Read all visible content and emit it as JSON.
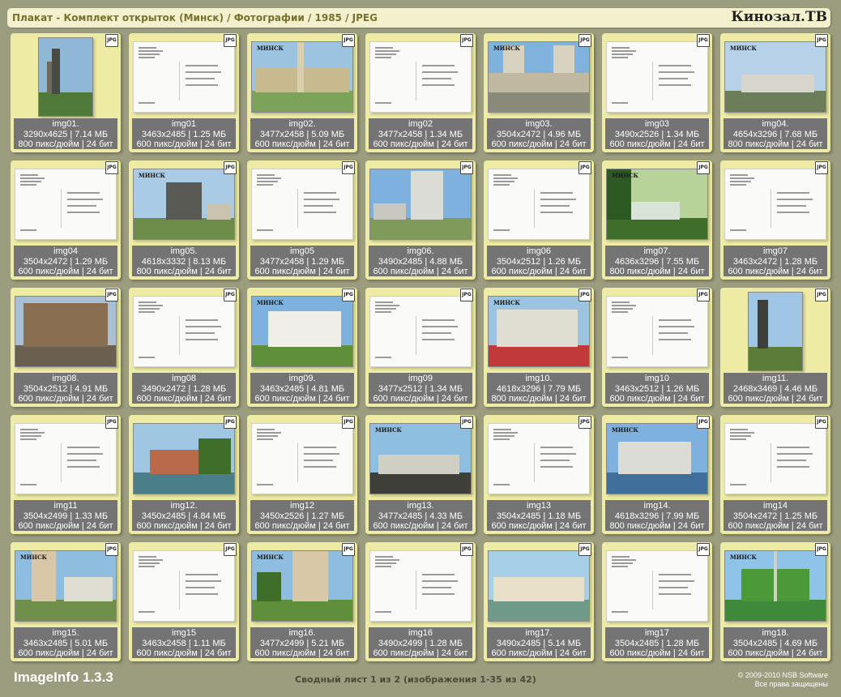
{
  "header": {
    "title": "Плакат - Комплект открыток (Минск) / Фотографии / 1985 / JPEG",
    "brand": "Кинозал.ТВ"
  },
  "thumbnail_badge": "JPG",
  "photo_caption": "МИНСК",
  "tiles": [
    {
      "kind": "photo",
      "orient": "portrait",
      "scene": "monument",
      "caption": false,
      "name": "img01.",
      "size": "3290x4625 | 7.14 МБ",
      "res": "800 пикс/дюйм | 24 бит"
    },
    {
      "kind": "back",
      "orient": "landscape",
      "name": "img01",
      "size": "3463x2485 | 1.25 МБ",
      "res": "600 пикс/дюйм | 24 бит"
    },
    {
      "kind": "photo",
      "orient": "landscape",
      "scene": "square",
      "caption": true,
      "name": "img02.",
      "size": "3477x2458 | 5.09 МБ",
      "res": "600 пикс/дюйм | 24 бит"
    },
    {
      "kind": "back",
      "orient": "landscape",
      "name": "img02",
      "size": "3477x2458 | 1.34 МБ",
      "res": "600 пикс/дюйм | 24 бит"
    },
    {
      "kind": "photo",
      "orient": "landscape",
      "scene": "towers",
      "caption": true,
      "name": "img03.",
      "size": "3504x2472 | 4.96 МБ",
      "res": "600 пикс/дюйм | 24 бит"
    },
    {
      "kind": "back",
      "orient": "landscape",
      "name": "img03",
      "size": "3490x2526 | 1.34 МБ",
      "res": "600 пикс/дюйм | 24 бит"
    },
    {
      "kind": "photo",
      "orient": "landscape",
      "scene": "avenue",
      "caption": true,
      "name": "img04.",
      "size": "4654x3296 | 7.68 МБ",
      "res": "800 пикс/дюйм | 24 бит"
    },
    {
      "kind": "back",
      "orient": "landscape",
      "name": "img04",
      "size": "3504x2472 | 1.29 МБ",
      "res": "600 пикс/дюйм | 24 бит"
    },
    {
      "kind": "photo",
      "orient": "landscape",
      "scene": "statue",
      "caption": true,
      "name": "img05.",
      "size": "4618x3332 | 8.13 МБ",
      "res": "800 пикс/дюйм | 24 бит"
    },
    {
      "kind": "back",
      "orient": "landscape",
      "name": "img05",
      "size": "3477x2458 | 1.29 МБ",
      "res": "600 пикс/дюйм | 24 бит"
    },
    {
      "kind": "photo",
      "orient": "landscape",
      "scene": "hotel",
      "caption": false,
      "name": "img06.",
      "size": "3490x2485 | 4.88 МБ",
      "res": "600 пикс/дюйм | 24 бит"
    },
    {
      "kind": "back",
      "orient": "landscape",
      "name": "img06",
      "size": "3504x2512 | 1.26 МБ",
      "res": "600 пикс/дюйм | 24 бит"
    },
    {
      "kind": "photo",
      "orient": "landscape",
      "scene": "park",
      "caption": true,
      "name": "img07.",
      "size": "4636x3296 | 7.55 МБ",
      "res": "800 пикс/дюйм | 24 бит"
    },
    {
      "kind": "back",
      "orient": "landscape",
      "name": "img07",
      "size": "3463x2472 | 1.28 МБ",
      "res": "600 пикс/дюйм | 24 бит"
    },
    {
      "kind": "photo",
      "orient": "landscape",
      "scene": "classic",
      "caption": false,
      "name": "img08.",
      "size": "3504x2512 | 4.91 МБ",
      "res": "600 пикс/дюйм | 24 бит"
    },
    {
      "kind": "back",
      "orient": "landscape",
      "name": "img08",
      "size": "3490x2472 | 1.28 МБ",
      "res": "600 пикс/дюйм | 24 бит"
    },
    {
      "kind": "photo",
      "orient": "landscape",
      "scene": "white",
      "caption": true,
      "name": "img09.",
      "size": "3463x2485 | 4.81 МБ",
      "res": "600 пикс/дюйм | 24 бит"
    },
    {
      "kind": "back",
      "orient": "landscape",
      "name": "img09",
      "size": "3477x2512 | 1.34 МБ",
      "res": "600 пикс/дюйм | 24 бит"
    },
    {
      "kind": "photo",
      "orient": "landscape",
      "scene": "flowers",
      "caption": true,
      "name": "img10.",
      "size": "4618x3296 | 7.79 МБ",
      "res": "800 пикс/дюйм | 24 бит"
    },
    {
      "kind": "back",
      "orient": "landscape",
      "name": "img10",
      "size": "3463x2512 | 1.26 МБ",
      "res": "600 пикс/дюйм | 24 бит"
    },
    {
      "kind": "photo",
      "orient": "portrait",
      "scene": "statue2",
      "caption": false,
      "name": "img11.",
      "size": "2468x3469 | 4.46 МБ",
      "res": "600 пикс/дюйм | 24 бит"
    },
    {
      "kind": "back",
      "orient": "landscape",
      "name": "img11",
      "size": "3504x2499 | 1.33 МБ",
      "res": "600 пикс/дюйм | 24 бит"
    },
    {
      "kind": "photo",
      "orient": "landscape",
      "scene": "river",
      "caption": false,
      "name": "img12.",
      "size": "3450x2485 | 4.84 МБ",
      "res": "600 пикс/дюйм | 24 бит"
    },
    {
      "kind": "back",
      "orient": "landscape",
      "name": "img12",
      "size": "3450x2526 | 1.27 МБ",
      "res": "600 пикс/дюйм | 24 бит"
    },
    {
      "kind": "photo",
      "orient": "landscape",
      "scene": "railing",
      "caption": true,
      "name": "img13.",
      "size": "3477x2485 | 4.33 МБ",
      "res": "600 пикс/дюйм | 24 бит"
    },
    {
      "kind": "back",
      "orient": "landscape",
      "name": "img13",
      "size": "3504x2485 | 1.18 МБ",
      "res": "600 пикс/дюйм | 24 бит"
    },
    {
      "kind": "photo",
      "orient": "landscape",
      "scene": "lake",
      "caption": true,
      "name": "img14.",
      "size": "4618x3296 | 7.99 МБ",
      "res": "800 пикс/дюйм | 24 бит"
    },
    {
      "kind": "back",
      "orient": "landscape",
      "name": "img14",
      "size": "3504x2472 | 1.25 МБ",
      "res": "600 пикс/дюйм | 24 бит"
    },
    {
      "kind": "photo",
      "orient": "landscape",
      "scene": "tower",
      "caption": true,
      "name": "img15.",
      "size": "3463x2485 | 5.01 МБ",
      "res": "600 пикс/дюйм | 24 бит"
    },
    {
      "kind": "back",
      "orient": "landscape",
      "name": "img15",
      "size": "3463x2458 | 1.11 МБ",
      "res": "600 пикс/дюйм | 24 бит"
    },
    {
      "kind": "photo",
      "orient": "landscape",
      "scene": "highrise",
      "caption": true,
      "name": "img16.",
      "size": "3477x2499 | 5.21 МБ",
      "res": "600 пикс/дюйм | 24 бит"
    },
    {
      "kind": "back",
      "orient": "landscape",
      "name": "img16",
      "size": "3490x2499 | 1.28 МБ",
      "res": "600 пикс/дюйм | 24 бит"
    },
    {
      "kind": "photo",
      "orient": "landscape",
      "scene": "pond",
      "caption": false,
      "name": "img17.",
      "size": "3490x2485 | 5.14 МБ",
      "res": "600 пикс/дюйм | 24 бит"
    },
    {
      "kind": "back",
      "orient": "landscape",
      "name": "img17",
      "size": "3504x2485 | 1.28 МБ",
      "res": "600 пикс/дюйм | 24 бит"
    },
    {
      "kind": "photo",
      "orient": "landscape",
      "scene": "mound",
      "caption": true,
      "name": "img18.",
      "size": "3504x2485 | 4.69 МБ",
      "res": "600 пикс/дюйм | 24 бит"
    }
  ],
  "footer": {
    "app_name": "ImageInfo 1.3.3",
    "sheet_info": "Сводный лист 1 из 2 (изображения 1-35 из 42)",
    "copyright_line1": "© 2009-2010 NSB Software",
    "copyright_line2": "Все права защищены"
  },
  "colors": {
    "background": "#9c9c7e",
    "tile": "#eeeca4",
    "info_panel": "#747474",
    "title_bar": "#f3f1cd",
    "title_text": "#7a6f2c"
  }
}
